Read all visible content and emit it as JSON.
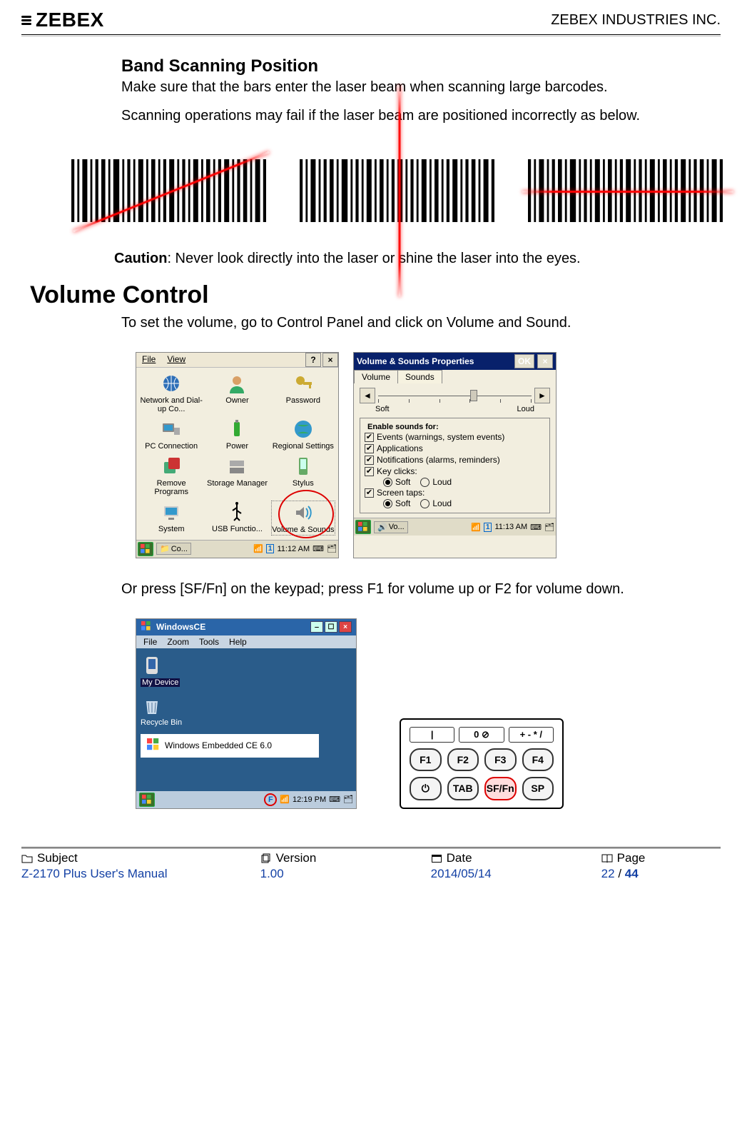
{
  "header": {
    "brand_text": "ZEBEX",
    "company": "ZEBEX INDUSTRIES INC."
  },
  "section1": {
    "title": "Band Scanning Position",
    "para1": "Make sure that the bars enter the laser beam when scanning large barcodes.",
    "para2": "Scanning operations may fail if the laser beam are positioned incorrectly as below.",
    "caution_prefix": "Caution",
    "caution_text": ": Never look directly into the laser or shine the laser into the eyes."
  },
  "section2": {
    "title": "Volume Control",
    "para1": "To set the volume, go to Control Panel and click on Volume and Sound.",
    "para2": "Or press [SF/Fn] on the keypad; press F1 for volume up or F2 for volume down."
  },
  "control_panel": {
    "menu_file": "File",
    "menu_view": "View",
    "help_btn": "?",
    "close_btn": "×",
    "items": [
      "Network and Dial-up Co...",
      "Owner",
      "Password",
      "PC Connection",
      "Power",
      "Regional Settings",
      "Remove Programs",
      "Storage Manager",
      "Stylus",
      "System",
      "USB Functio...",
      "Volume & Sounds"
    ],
    "task_name": "Co...",
    "task_time": "11:12 AM"
  },
  "volume_props": {
    "title": "Volume & Sounds Properties",
    "ok": "OK",
    "close": "×",
    "tab_volume": "Volume",
    "tab_sounds": "Sounds",
    "scale_left": "Soft",
    "scale_right": "Loud",
    "group_title": "Enable sounds for:",
    "chk_events": "Events (warnings, system events)",
    "chk_apps": "Applications",
    "chk_notif": "Notifications (alarms, reminders)",
    "chk_keys": "Key clicks:",
    "chk_taps": "Screen taps:",
    "radio_soft": "Soft",
    "radio_loud": "Loud",
    "task_name": "Vo...",
    "task_time": "11:13 AM"
  },
  "ce_desktop": {
    "title": "WindowsCE",
    "menu": [
      "File",
      "Zoom",
      "Tools",
      "Help"
    ],
    "icon1": "My Device",
    "icon2": "Recycle Bin",
    "splash": "Windows Embedded CE 6.0",
    "task_time": "12:19 PM"
  },
  "keypad": {
    "top": [
      "|",
      "0 ⊘",
      "+ - * /"
    ],
    "row_f": [
      "F1",
      "F2",
      "F3",
      "F4"
    ],
    "row_b": [
      "⏻",
      "TAB",
      "SF/Fn",
      "SP"
    ]
  },
  "footer": {
    "lbl_subject": "Subject",
    "val_subject": "Z-2170 Plus User's Manual",
    "lbl_version": "Version",
    "val_version": "1.00",
    "lbl_date": "Date",
    "val_date": "2014/05/14",
    "lbl_page": "Page",
    "page_current": "22",
    "page_sep": " / ",
    "page_total": "44"
  }
}
